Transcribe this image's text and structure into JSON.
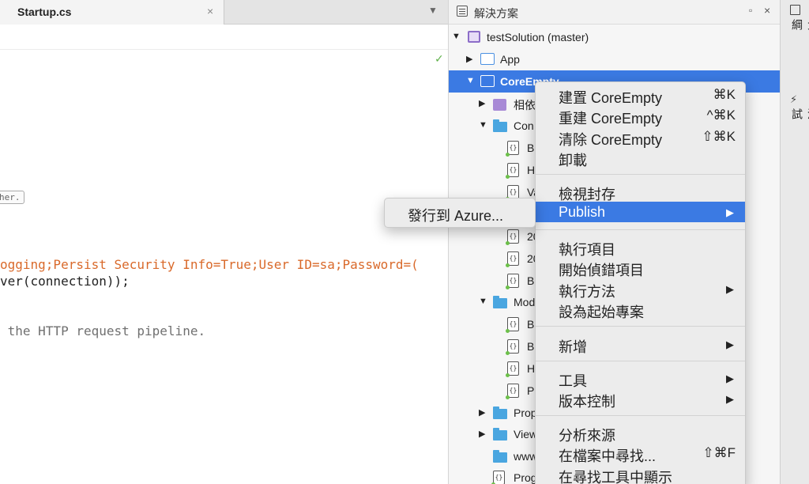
{
  "editor": {
    "tab_title": "Startup.cs",
    "tab_close": "×",
    "tab_dropdown": "▼",
    "status_check": "✓",
    "inline_hint": "her.",
    "code_lines": [
      "ogging;Persist Security Info=True;User ID=sa;Password=(",
      "ver(connection));",
      " the HTTP request pipeline."
    ]
  },
  "solution_panel": {
    "title": "解決方案",
    "minimize": "▫",
    "close": "×",
    "rows": [
      {
        "label": "testSolution (master)",
        "arrow": "▼",
        "icon": "solution-icon"
      },
      {
        "label": "App",
        "arrow": "▶",
        "icon": "project-icon"
      },
      {
        "label": "CoreEmpty",
        "arrow": "▼",
        "icon": "project-icon",
        "selected": true
      },
      {
        "label": "相依",
        "arrow": "▶",
        "icon": "dependencies-icon"
      },
      {
        "label": "Con",
        "arrow": "▼",
        "icon": "folder-icon"
      },
      {
        "label": "B",
        "icon": "cs-file-icon"
      },
      {
        "label": "H",
        "icon": "cs-file-icon"
      },
      {
        "label": "Va",
        "icon": "cs-file-icon"
      },
      {
        "label": "20",
        "icon": "cs-file-icon"
      },
      {
        "label": "20",
        "icon": "cs-file-icon"
      },
      {
        "label": "B",
        "icon": "cs-file-icon"
      },
      {
        "label": "Mod",
        "arrow": "▼",
        "icon": "folder-icon"
      },
      {
        "label": "B",
        "icon": "cs-file-icon"
      },
      {
        "label": "B",
        "icon": "cs-file-icon"
      },
      {
        "label": "H",
        "icon": "cs-file-icon"
      },
      {
        "label": "Pe",
        "icon": "cs-file-icon"
      },
      {
        "label": "Prop",
        "arrow": "▶",
        "icon": "folder-icon"
      },
      {
        "label": "View",
        "arrow": "▶",
        "icon": "folder-icon"
      },
      {
        "label": "www",
        "icon": "folder-icon"
      },
      {
        "label": "Prog",
        "icon": "cs-file-icon"
      }
    ],
    "file_icon_glyph": "{}"
  },
  "right_sidebar": {
    "outline_label": "文件大綱",
    "tests_icon": "⚡",
    "tests_label": "單元測試"
  },
  "context_menu": {
    "items": [
      {
        "label": "建置 CoreEmpty",
        "shortcut": "⌘K"
      },
      {
        "label": "重建 CoreEmpty",
        "shortcut": "^⌘K"
      },
      {
        "label": "清除 CoreEmpty",
        "shortcut": "⇧⌘K"
      },
      {
        "label": "卸載"
      },
      {
        "label": "檢視封存"
      },
      {
        "label": "Publish",
        "submenu": "▶",
        "active": true
      },
      {
        "label": "執行項目"
      },
      {
        "label": "開始偵錯項目"
      },
      {
        "label": "執行方法",
        "submenu": "▶"
      },
      {
        "label": "設為起始專案"
      },
      {
        "label": "新增",
        "submenu": "▶"
      },
      {
        "label": "工具",
        "submenu": "▶"
      },
      {
        "label": "版本控制",
        "submenu": "▶"
      },
      {
        "label": "分析來源"
      },
      {
        "label": "在檔案中尋找...",
        "shortcut": "⇧⌘F"
      },
      {
        "label": "在尋找工具中顯示"
      }
    ]
  },
  "submenu": {
    "item_label": "發行到 Azure..."
  },
  "colors": {
    "selection": "#3b7ae3",
    "code_string": "#d9692a",
    "folder": "#4aa6e0"
  }
}
